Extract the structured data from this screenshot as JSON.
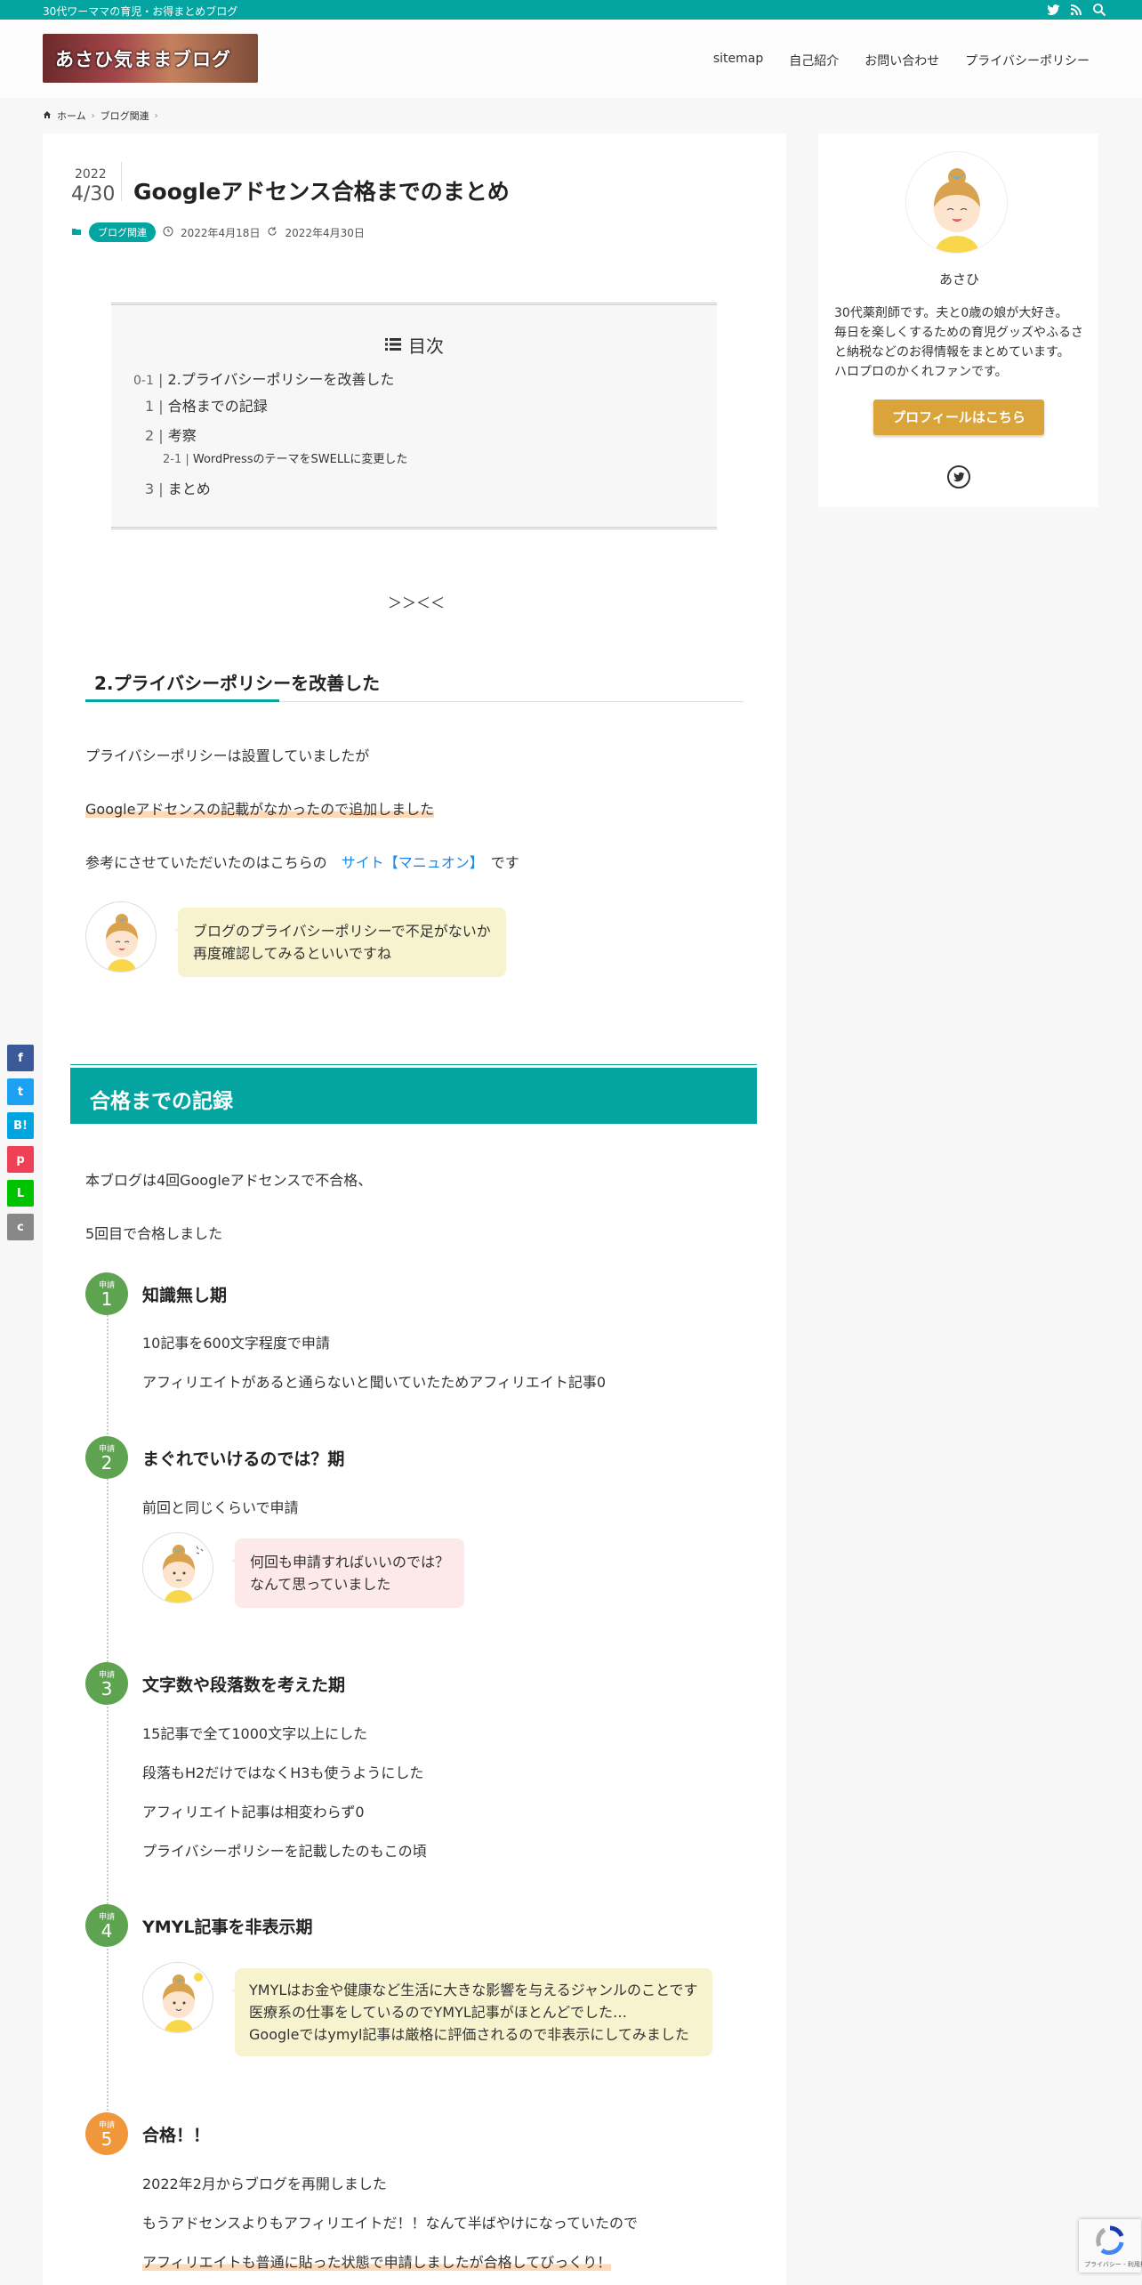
{
  "topbar": {
    "tagline": "30代ワーママの育児・お得まとめブログ"
  },
  "header": {
    "logo_text": "あさひ気ままブログ",
    "nav": [
      "sitemap",
      "自己紹介",
      "お問い合わせ",
      "プライバシーポリシー"
    ]
  },
  "breadcrumb": {
    "home": "ホーム",
    "category": "ブログ関連"
  },
  "post": {
    "year": "2022",
    "date": "4/30",
    "title": "Googleアドセンス合格までのまとめ",
    "category": "ブログ関連",
    "published": "2022年4月18日",
    "updated": "2022年4月30日"
  },
  "toc": {
    "heading": "目次",
    "items": [
      {
        "num": "0-1",
        "label": "2.プライバシーポリシーを改善した"
      },
      {
        "num": "1",
        "label": "合格までの記録"
      },
      {
        "num": "2",
        "label": "考察"
      },
      {
        "num": "2-1",
        "label": "WordPressのテーマをSWELLに変更した"
      },
      {
        "num": "3",
        "label": "まとめ"
      }
    ]
  },
  "arrows": "＞＞＜＜",
  "section1": {
    "heading": "2.プライバシーポリシーを改善した",
    "p1": "プライバシーポリシーは設置していましたが",
    "p2": "Googleアドセンスの記載がなかったので追加しました",
    "p3_pre": "参考にさせていただいたのはこちらの",
    "p3_link": "サイト【マニュオン】",
    "p3_post": "です",
    "bubble_l1": "ブログのプライバシーポリシーで不足がないか",
    "bubble_l2": "再度確認してみるといいですね"
  },
  "section2": {
    "heading": "合格までの記録",
    "p1": "本ブログは4回Googleアドセンスで不合格、",
    "p2": "5回目で合格しました",
    "step_label": "申請",
    "steps": [
      {
        "num": "1",
        "title": "知識無し期",
        "lines": [
          "10記事を600文字程度で申請",
          "アフィリエイトがあると通らないと聞いていたためアフィリエイト記事0"
        ]
      },
      {
        "num": "2",
        "title": "まぐれでいけるのでは？期",
        "lines": [
          "前回と同じくらいで申請"
        ],
        "bubble": [
          "何回も申請すればいいのでは？",
          "なんて思っていました"
        ]
      },
      {
        "num": "3",
        "title": "文字数や段落数を考えた期",
        "lines": [
          "15記事で全て1000文字以上にした",
          "段落もH2だけではなくH3も使うようにした",
          "アフィリエイト記事は相変わらず0",
          "プライバシーポリシーを記載したのもこの頃"
        ]
      },
      {
        "num": "4",
        "title": "YMYL記事を非表示期",
        "bubble": [
          "YMYLはお金や健康など生活に大きな影響を与えるジャンルのことです",
          "医療系の仕事をしているのでYMYL記事がほとんどでした…",
          "Googleではymyl記事は厳格に評価されるので非表示にしてみました"
        ]
      },
      {
        "num": "5",
        "title": "合格！！",
        "lines": [
          "2022年2月からブログを再開しました",
          "もうアドセンスよりもアフィリエイトだ！！なんて半ばやけになっていたので",
          "アフィリエイトも普通に貼った状態で申請しましたが合格してびっくり！"
        ]
      }
    ]
  },
  "profile": {
    "name": "あさひ",
    "bio": [
      "30代薬剤師です。夫と0歳の娘が大好き。",
      "毎日を楽しくするための育児グッズやふるさと納税などのお得情報をまとめています。",
      "ハロプロのかくれファンです。"
    ],
    "button": "プロフィールはこちら"
  },
  "share": [
    "f",
    "t",
    "B!",
    "p",
    "L",
    "c"
  ],
  "recaptcha": "プライバシー - 利用規約"
}
